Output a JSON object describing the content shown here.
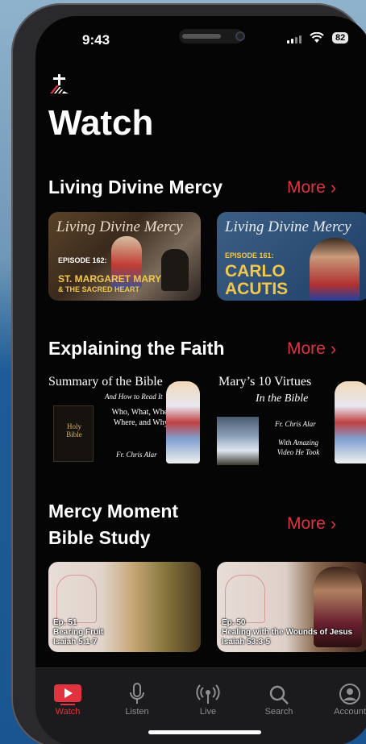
{
  "status": {
    "time": "9:43",
    "battery": "82"
  },
  "page": {
    "title": "Watch"
  },
  "sections": [
    {
      "title": "Living Divine Mercy",
      "more_label": "More",
      "items": [
        {
          "script_title": "Living Divine Mercy",
          "episode": "EPISODE 162:",
          "line1": "ST. MARGARET MARY",
          "line2": "& THE SACRED HEART"
        },
        {
          "script_title": "Living Divine Mercy",
          "episode": "EPISODE 161:",
          "line1": "CARLO",
          "line2": "ACUTIS"
        }
      ]
    },
    {
      "title": "Explaining the Faith",
      "more_label": "More",
      "items": [
        {
          "title": "Summary of the Bible",
          "subtitle": "And How to Read It",
          "body": "Who, What, When, Where, and Why?",
          "author": "Fr. Chris Alar",
          "book": "Holy Bible"
        },
        {
          "title": "Mary’s 10 Virtues",
          "subtitle": "In the Bible",
          "author": "Fr. Chris Alar",
          "body": "With Amazing Video He Took"
        }
      ]
    },
    {
      "title_line1": "Mercy Moment",
      "title_line2": "Bible Study",
      "more_label": "More",
      "items": [
        {
          "ep": "Ep. 51",
          "title": "Bearing Fruit",
          "ref": "Isaiah 5:1-7"
        },
        {
          "ep": "Ep. 50",
          "title": "Healing with the Wounds of Jesus",
          "ref": "Isaiah 53:3-5"
        }
      ]
    }
  ],
  "tabs": [
    {
      "label": "Watch",
      "icon": "play-icon"
    },
    {
      "label": "Listen",
      "icon": "microphone-icon"
    },
    {
      "label": "Live",
      "icon": "broadcast-icon"
    },
    {
      "label": "Search",
      "icon": "search-icon"
    },
    {
      "label": "Account",
      "icon": "account-icon"
    }
  ],
  "colors": {
    "accent": "#e0333f",
    "background": "#050505",
    "tabbar": "#1b1b1d"
  }
}
